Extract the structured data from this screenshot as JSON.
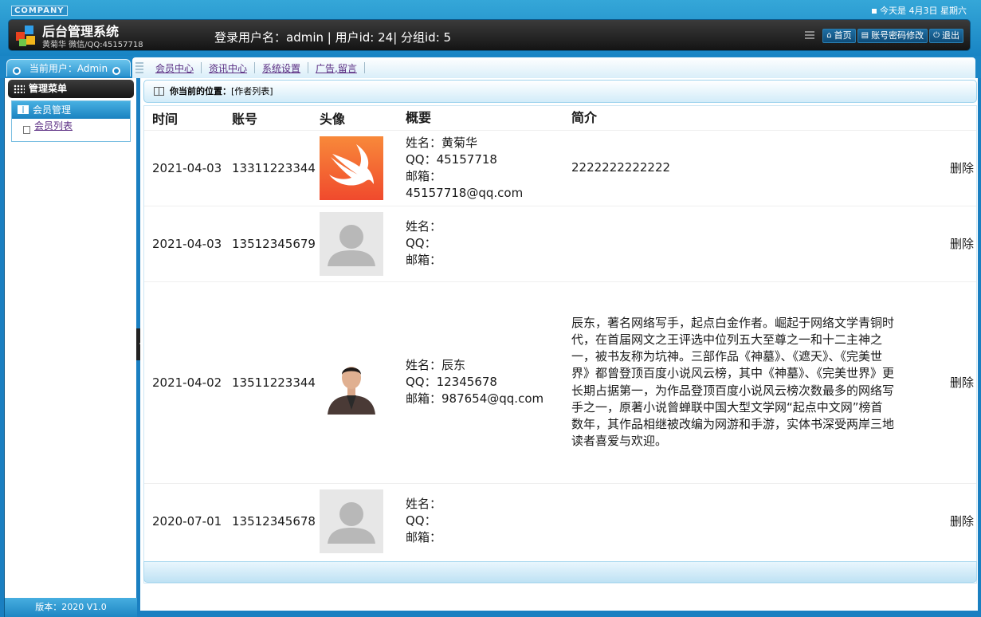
{
  "header": {
    "company": "COMPANY",
    "date_text": "今天是 4月3日  星期六",
    "title": "后台管理系统",
    "subtitle": "黄菊华 微信/QQ:45157718",
    "login_info": "登录用户名：admin | 用户id: 24| 分组id: 5",
    "actions": {
      "home": "首页",
      "password": "账号密码修改",
      "logout": "退出"
    }
  },
  "nav": {
    "current_user": "当前用户：Admin",
    "menu": [
      "会员中心",
      "资讯中心",
      "系统设置",
      "广告,留言"
    ]
  },
  "sidebar": {
    "title": "管理菜单",
    "group": "会员管理",
    "item": "会员列表",
    "version": "版本：2020 V1.0"
  },
  "breadcrumb": {
    "label": "你当前的位置：",
    "value": "[作者列表]"
  },
  "table": {
    "headers": [
      "时间",
      "账号",
      "头像",
      "概要",
      "简介"
    ],
    "rows": [
      {
        "time": "2021-04-03",
        "account": "13311223344",
        "avatar": "swift-logo",
        "name": "姓名：黄菊华",
        "qq": "QQ：45157718",
        "email_label": "邮箱：",
        "email": "45157718@qq.com",
        "bio": "2222222222222",
        "action": "删除"
      },
      {
        "time": "2021-04-03",
        "account": "13512345679",
        "avatar": "default-avatar",
        "name": "姓名：",
        "qq": "QQ：",
        "email_label": "邮箱：",
        "email": "",
        "bio": "",
        "action": "删除"
      },
      {
        "time": "2021-04-02",
        "account": "13511223344",
        "avatar": "person-photo",
        "name": "姓名：辰东",
        "qq": "QQ：12345678",
        "email_label": "邮箱：",
        "email": "987654@qq.com",
        "bio": "辰东，著名网络写手，起点白金作者。崛起于网络文学青铜时代，在首届网文之王评选中位列五大至尊之一和十二主神之一，被书友称为坑神。三部作品《神墓》、《遮天》、《完美世界》都曾登顶百度小说风云榜，其中《神墓》、《完美世界》更长期占据第一，为作品登顶百度小说风云榜次数最多的网络写手之一，原著小说曾蝉联中国大型文学网“起点中文网”榜首数年，其作品相继被改编为网游和手游，实体书深受两岸三地读者喜爱与欢迎。",
        "action": "删除"
      },
      {
        "time": "2020-07-01",
        "account": "13512345678",
        "avatar": "default-avatar",
        "name": "姓名：",
        "qq": "QQ：",
        "email_label": "邮箱：",
        "email": "",
        "bio": "",
        "action": "删除"
      }
    ]
  }
}
